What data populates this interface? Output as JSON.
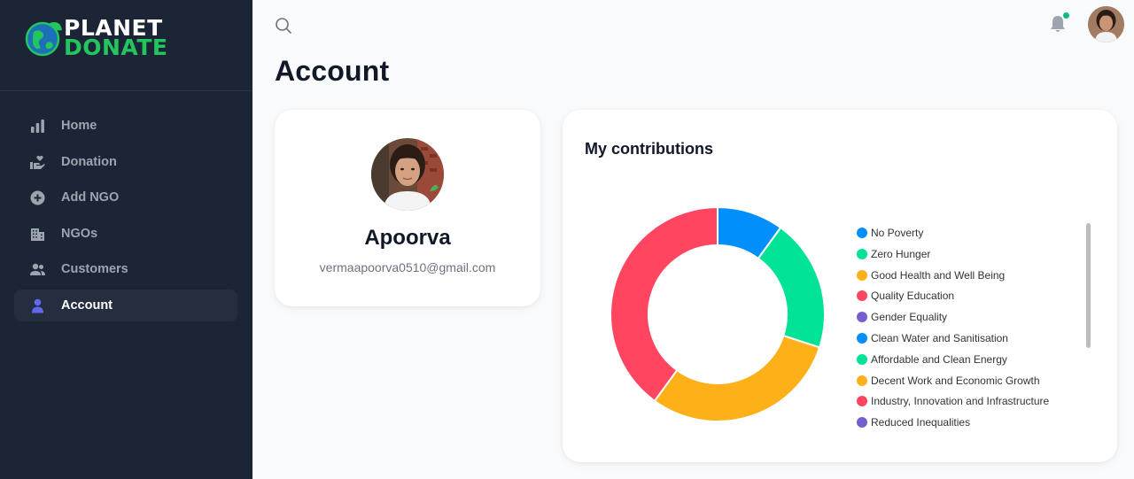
{
  "brand": {
    "line1": "PLANET",
    "line2": "DONATE"
  },
  "sidebar": {
    "items": [
      {
        "label": "Home",
        "icon": "bar-chart-icon"
      },
      {
        "label": "Donation",
        "icon": "hand-heart-icon"
      },
      {
        "label": "Add NGO",
        "icon": "plus-circle-icon"
      },
      {
        "label": "NGOs",
        "icon": "building-icon"
      },
      {
        "label": "Customers",
        "icon": "users-icon"
      },
      {
        "label": "Account",
        "icon": "user-icon",
        "active": true
      }
    ]
  },
  "header": {
    "title": "Account"
  },
  "profile": {
    "name": "Apoorva",
    "email": "vermaapoorva0510@gmail.com"
  },
  "contributions": {
    "title": "My contributions"
  },
  "chart_data": {
    "type": "pie",
    "categories": [
      "No Poverty",
      "Zero Hunger",
      "Good Health and Well Being",
      "Quality Education",
      "Gender Equality",
      "Clean Water and Sanitisation",
      "Affordable and Clean Energy",
      "Decent Work and Economic Growth",
      "Industry, Innovation and Infrastructure",
      "Reduced Inequalities"
    ],
    "colors": [
      "#008ffb",
      "#00e396",
      "#feb019",
      "#ff4560",
      "#775dd0",
      "#008ffb",
      "#00e396",
      "#feb019",
      "#ff4560",
      "#775dd0"
    ],
    "values": [
      10,
      20,
      30,
      40,
      0,
      0,
      0,
      0,
      0,
      0
    ],
    "legend_position": "right"
  },
  "colors": {
    "sidebar_bg": "#1c2536",
    "brand_green": "#22c55e",
    "notification_dot": "#10b981",
    "active_icon": "#6366f1"
  }
}
